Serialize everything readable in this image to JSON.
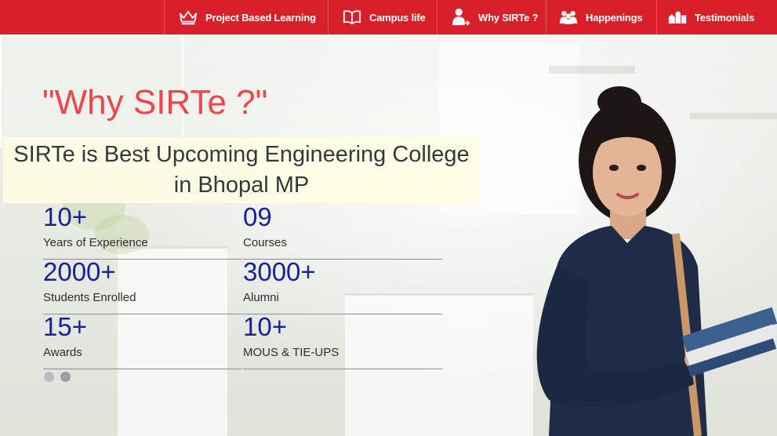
{
  "nav": {
    "items": [
      {
        "label": "Project Based Learning",
        "icon": "crown-icon"
      },
      {
        "label": "Campus life",
        "icon": "open-book-icon"
      },
      {
        "label": "Why SIRTe ?",
        "icon": "person-arrow-icon"
      },
      {
        "label": "Happenings",
        "icon": "people-group-icon"
      },
      {
        "label": "Testimonials",
        "icon": "buildings-icon"
      }
    ],
    "background": "#d9202a"
  },
  "hero": {
    "title": "\"Why SIRTe ?\"",
    "tagline_line1": "SIRTe is Best Upcoming Engineering College",
    "tagline_line2": "in Bhopal MP",
    "title_color": "#f0454b",
    "stat_color": "#16229a"
  },
  "stats": [
    {
      "value": "10+",
      "label": "Years of Experience"
    },
    {
      "value": "09",
      "label": "Courses"
    },
    {
      "value": "2000+",
      "label": "Students Enrolled"
    },
    {
      "value": "3000+",
      "label": "Alumni"
    },
    {
      "value": "15+",
      "label": "Awards"
    },
    {
      "value": "10+",
      "label": "MOUS & TIE-UPS"
    }
  ],
  "carousel": {
    "dot_count": 2,
    "active_index": 1
  }
}
